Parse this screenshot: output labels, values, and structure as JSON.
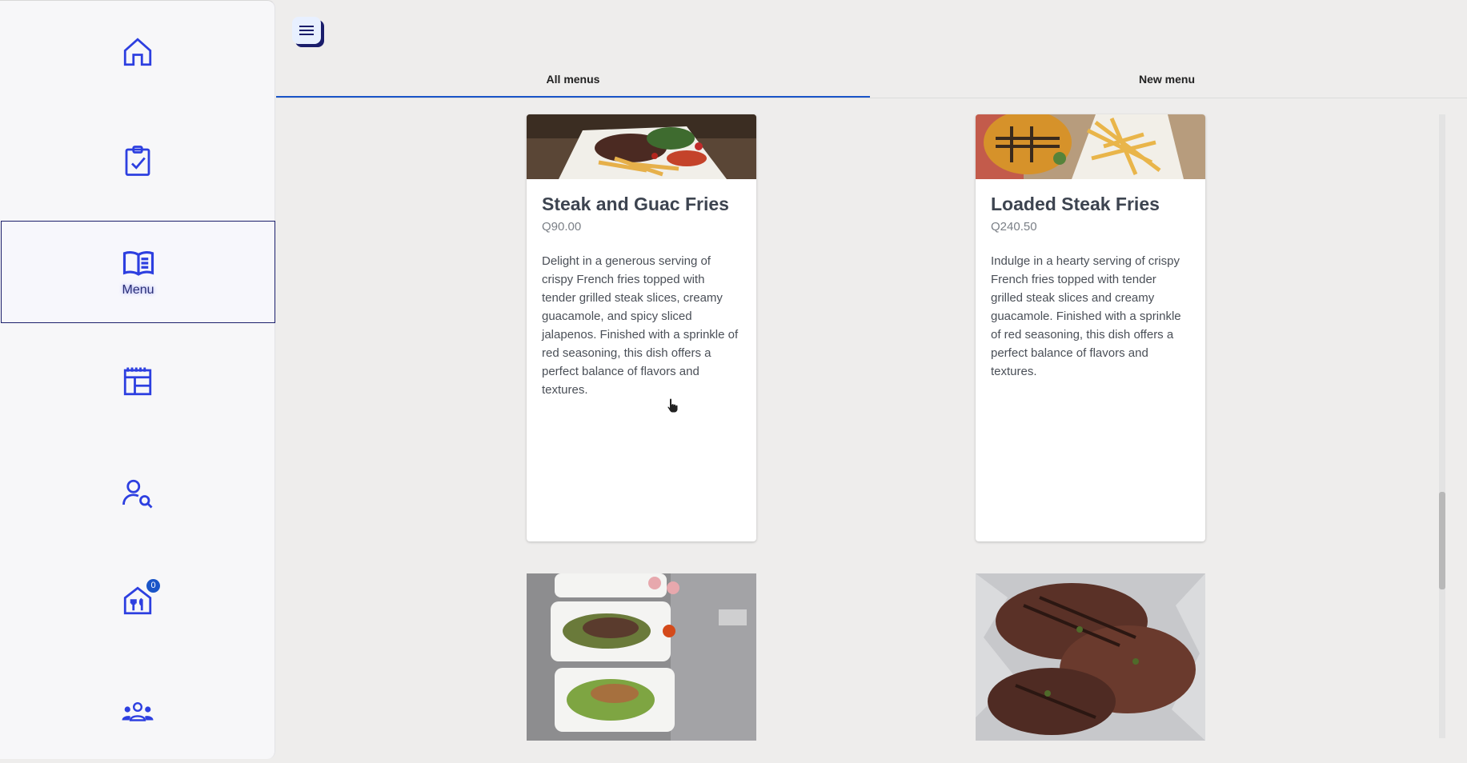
{
  "sidebar": {
    "items": [
      {
        "name": "home",
        "label": ""
      },
      {
        "name": "tasks",
        "label": ""
      },
      {
        "name": "menu",
        "label": "Menu",
        "active": true
      },
      {
        "name": "calendar",
        "label": ""
      },
      {
        "name": "customer-search",
        "label": ""
      },
      {
        "name": "restaurant",
        "label": "",
        "badge": "0"
      },
      {
        "name": "team",
        "label": ""
      }
    ]
  },
  "tabs": [
    {
      "label": "All menus",
      "active": true
    },
    {
      "label": "New menu",
      "active": false
    }
  ],
  "cards": [
    {
      "title": "Steak and Guac Fries",
      "price": "Q90.00",
      "description": "Delight in a generous serving of crispy French fries topped with tender grilled steak slices, creamy guacamole, and spicy sliced jalapenos. Finished with a sprinkle of red seasoning, this dish offers a perfect balance of flavors and textures."
    },
    {
      "title": "Loaded Steak Fries",
      "price": "Q240.50",
      "description": "Indulge in a hearty serving of crispy French fries topped with tender grilled steak slices and creamy guacamole. Finished with a sprinkle of red seasoning, this dish offers a perfect balance of flavors and textures."
    }
  ],
  "colors": {
    "accent": "#1a55c8",
    "icon": "#2d3fe0"
  }
}
